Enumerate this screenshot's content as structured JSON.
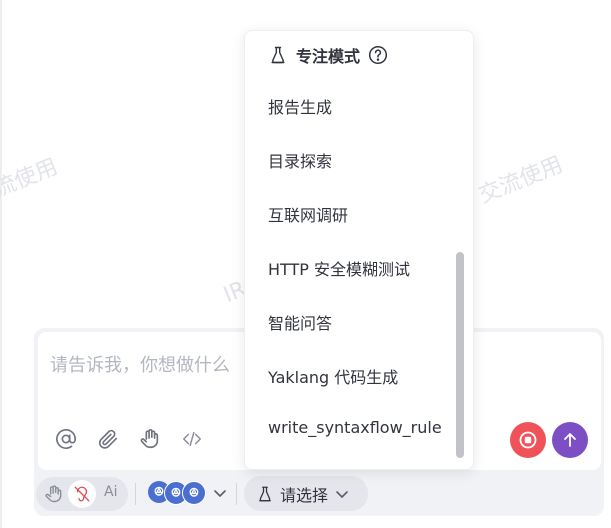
{
  "watermark": {
    "text_left": "流使用",
    "text_mid": "IR",
    "text_right": "交流使用"
  },
  "input": {
    "placeholder": "请告诉我，你想做什么"
  },
  "toolbar": {
    "icons": [
      "at-icon",
      "paperclip-icon",
      "hand-icon",
      "code-icon"
    ]
  },
  "actions": {
    "stop": "stop-icon",
    "send": "arrow-up-icon"
  },
  "bottom": {
    "select_label": "请选择",
    "ai_label": "Ai"
  },
  "dropdown": {
    "title": "专注模式",
    "items": [
      {
        "label": "报告生成"
      },
      {
        "label": "目录探索"
      },
      {
        "label": "互联网调研"
      },
      {
        "label": "HTTP 安全模糊测试"
      },
      {
        "label": "智能问答"
      },
      {
        "label": "Yaklang 代码生成"
      },
      {
        "label": "write_syntaxflow_rule"
      }
    ]
  },
  "colors": {
    "stop": "#f0525a",
    "send": "#7c4fc4",
    "badge": "#4a6fd1"
  }
}
